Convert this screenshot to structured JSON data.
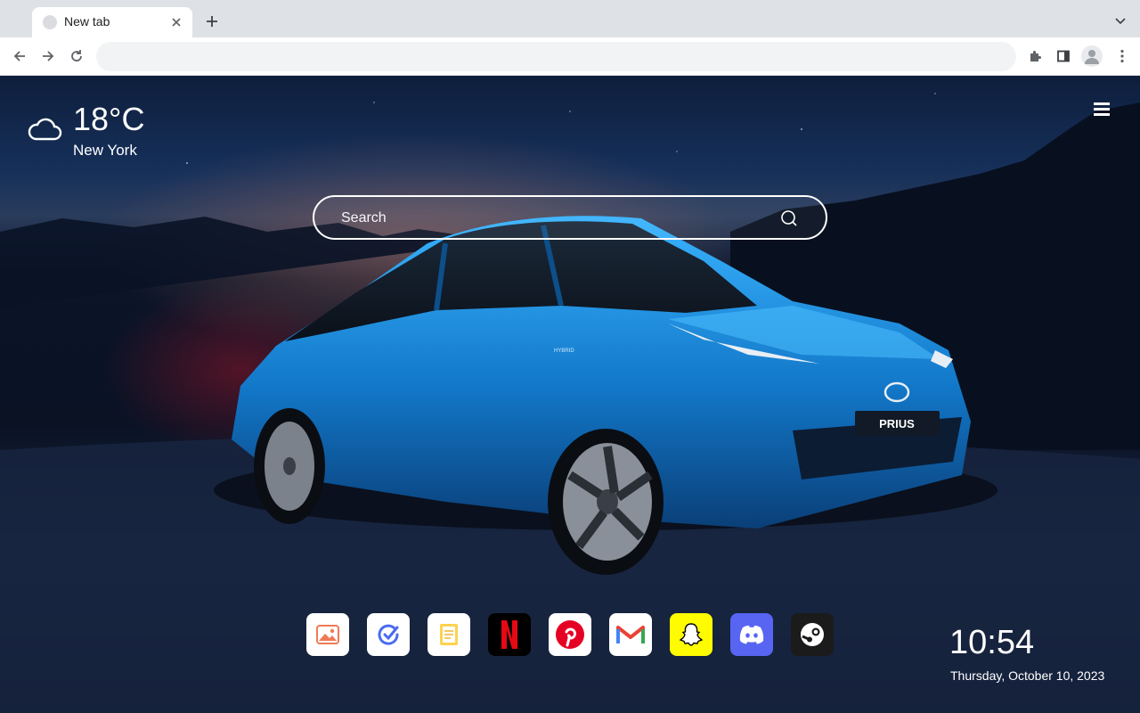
{
  "browser": {
    "tab_title": "New tab",
    "address_value": "",
    "icons": [
      "favicon-icon",
      "close-icon",
      "plus-icon",
      "chevron-down-icon",
      "back-arrow-icon",
      "forward-arrow-icon",
      "reload-icon",
      "extensions-icon",
      "side-panel-icon",
      "profile-icon",
      "more-vert-icon"
    ]
  },
  "weather": {
    "temperature": "18°C",
    "city": "New York",
    "icon": "cloud-icon"
  },
  "search": {
    "placeholder": "Search",
    "icon": "search-icon"
  },
  "dock": [
    {
      "name": "photos",
      "icon": "image-icon",
      "bg": "#ffffff"
    },
    {
      "name": "tasks",
      "icon": "check-circle-icon",
      "bg": "#ffffff"
    },
    {
      "name": "notes",
      "icon": "note-icon",
      "bg": "#ffffff"
    },
    {
      "name": "netflix",
      "icon": "netflix-icon",
      "bg": "#000000"
    },
    {
      "name": "pinterest",
      "icon": "pinterest-icon",
      "bg": "#ffffff"
    },
    {
      "name": "gmail",
      "icon": "gmail-icon",
      "bg": "#ffffff"
    },
    {
      "name": "snapchat",
      "icon": "snapchat-icon",
      "bg": "#fffc00"
    },
    {
      "name": "discord",
      "icon": "discord-icon",
      "bg": "#5865f2"
    },
    {
      "name": "steam",
      "icon": "steam-icon",
      "bg": "#1b1b1b"
    }
  ],
  "clock": {
    "time": "10:54",
    "date": "Thursday, October 10, 2023"
  },
  "car": {
    "plate_text": "PRIUS",
    "badge_text": "HYBRID"
  },
  "colors": {
    "accent_car": "#1e90e0",
    "tab_strip": "#dee1e6",
    "toolbar": "#ffffff"
  }
}
